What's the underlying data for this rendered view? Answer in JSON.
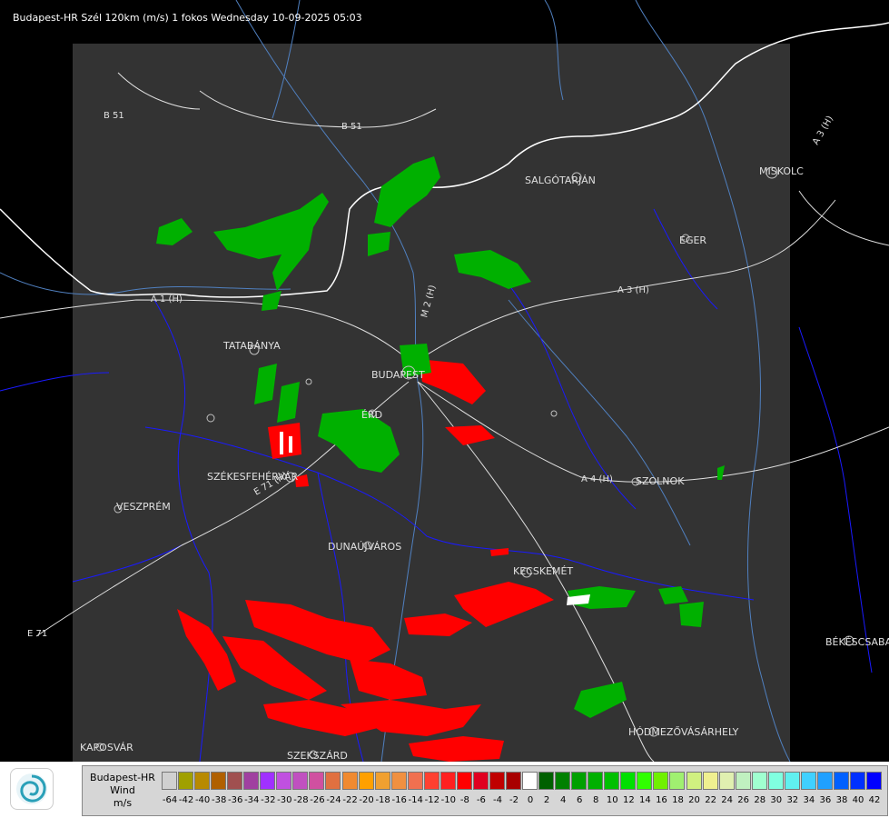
{
  "title": "Budapest-HR Szél 120km (m/s) 1 fokos Wednesday 10-09-2025 05:03",
  "places": [
    {
      "name": "SALGÓTARJÁN"
    },
    {
      "name": "EGER"
    },
    {
      "name": "MISKOLC"
    },
    {
      "name": "TATABÁNYA"
    },
    {
      "name": "BUDAPEST"
    },
    {
      "name": "ÉRD"
    },
    {
      "name": "SZÉKESFEHÉRVÁR"
    },
    {
      "name": "VESZPRÉM"
    },
    {
      "name": "SZOLNOK"
    },
    {
      "name": "DUNAÚJVÁROS"
    },
    {
      "name": "KECSKEMÉT"
    },
    {
      "name": "BÉKÉSCSABA"
    },
    {
      "name": "HÓDMEZŐVÁSÁRHELY"
    },
    {
      "name": "KAPOSVÁR"
    },
    {
      "name": "SZEKSZÁRD"
    }
  ],
  "roads": [
    "B 51",
    "B 51",
    "A 1 (H)",
    "M 2 (H)",
    "A 3 (H)",
    "A 3 (H)",
    "A 4 (H)",
    "E 71 (H)",
    "E 71"
  ],
  "legend": {
    "line1": "Budapest-HR",
    "line2": "Wind",
    "line3": "m/s",
    "values": [
      "-64",
      "-42",
      "-40",
      "-38",
      "-36",
      "-34",
      "-32",
      "-30",
      "-28",
      "-26",
      "-24",
      "-22",
      "-20",
      "-18",
      "-16",
      "-14",
      "-12",
      "-10",
      "-8",
      "-6",
      "-4",
      "-2",
      "0",
      "2",
      "4",
      "6",
      "8",
      "10",
      "12",
      "14",
      "16",
      "18",
      "20",
      "22",
      "24",
      "26",
      "28",
      "30",
      "32",
      "34",
      "36",
      "38",
      "40",
      "42"
    ],
    "colors": [
      "#d0d0d0",
      "#a0a000",
      "#b88a00",
      "#b06000",
      "#a05050",
      "#a040a0",
      "#a030ff",
      "#c050e0",
      "#c050c0",
      "#d050a0",
      "#e07040",
      "#f08a30",
      "#ffa000",
      "#f0a030",
      "#f09040",
      "#f07050",
      "#ff4030",
      "#ff2020",
      "#ff0000",
      "#e00020",
      "#c00000",
      "#a80000",
      "#ffffff",
      "#006000",
      "#008000",
      "#00a000",
      "#00b000",
      "#00c000",
      "#00e000",
      "#30ff00",
      "#70f000",
      "#a0f070",
      "#d0f080",
      "#f0f090",
      "#e0f0b0",
      "#c0f0c0",
      "#a0ffd0",
      "#80ffe0",
      "#60f0f0",
      "#40d0ff",
      "#20a0ff",
      "#0060ff",
      "#0030ff",
      "#0000ff"
    ]
  },
  "colors": {
    "background": "#000000",
    "radar_area": "#333333",
    "border_country": "#ffffff",
    "border_county": "#1a1aff",
    "river": "#5080c0",
    "road": "#e0e0e0",
    "echo_red": "#ff0000",
    "echo_green": "#00b000"
  }
}
